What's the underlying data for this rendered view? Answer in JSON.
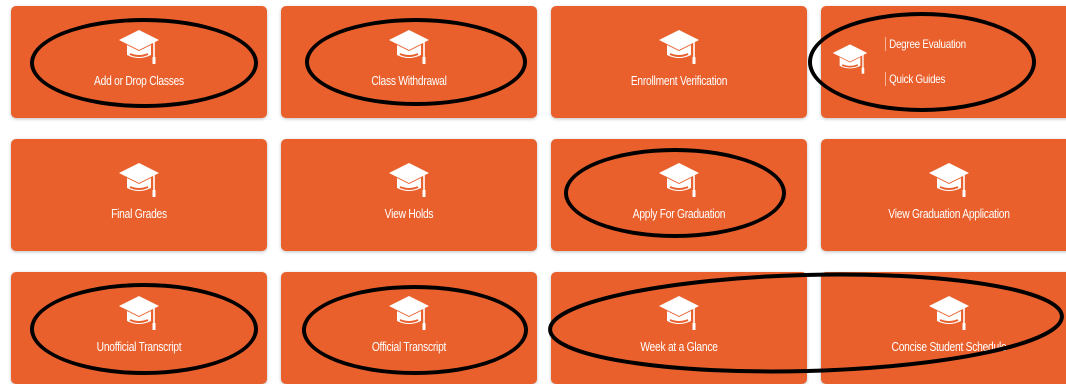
{
  "tiles": {
    "add_drop": "Add or Drop Classes",
    "withdrawal": "Class Withdrawal",
    "enrollment": "Enrollment Verification",
    "degree_eval": "Degree Evaluation",
    "quick_guides": "Quick Guides",
    "final_grades": "Final Grades",
    "view_holds": "View Holds",
    "apply_grad": "Apply For Graduation",
    "view_grad_app": "View Graduation Application",
    "unofficial": "Unofficial Transcript",
    "official": "Official Transcript",
    "week_glance": "Week at a Glance",
    "concise_schedule": "Concise Student Schedule"
  },
  "icon": "graduation-cap-icon",
  "colors": {
    "tile": "#e9602c",
    "text": "#ffffff",
    "annotation": "#000000"
  }
}
